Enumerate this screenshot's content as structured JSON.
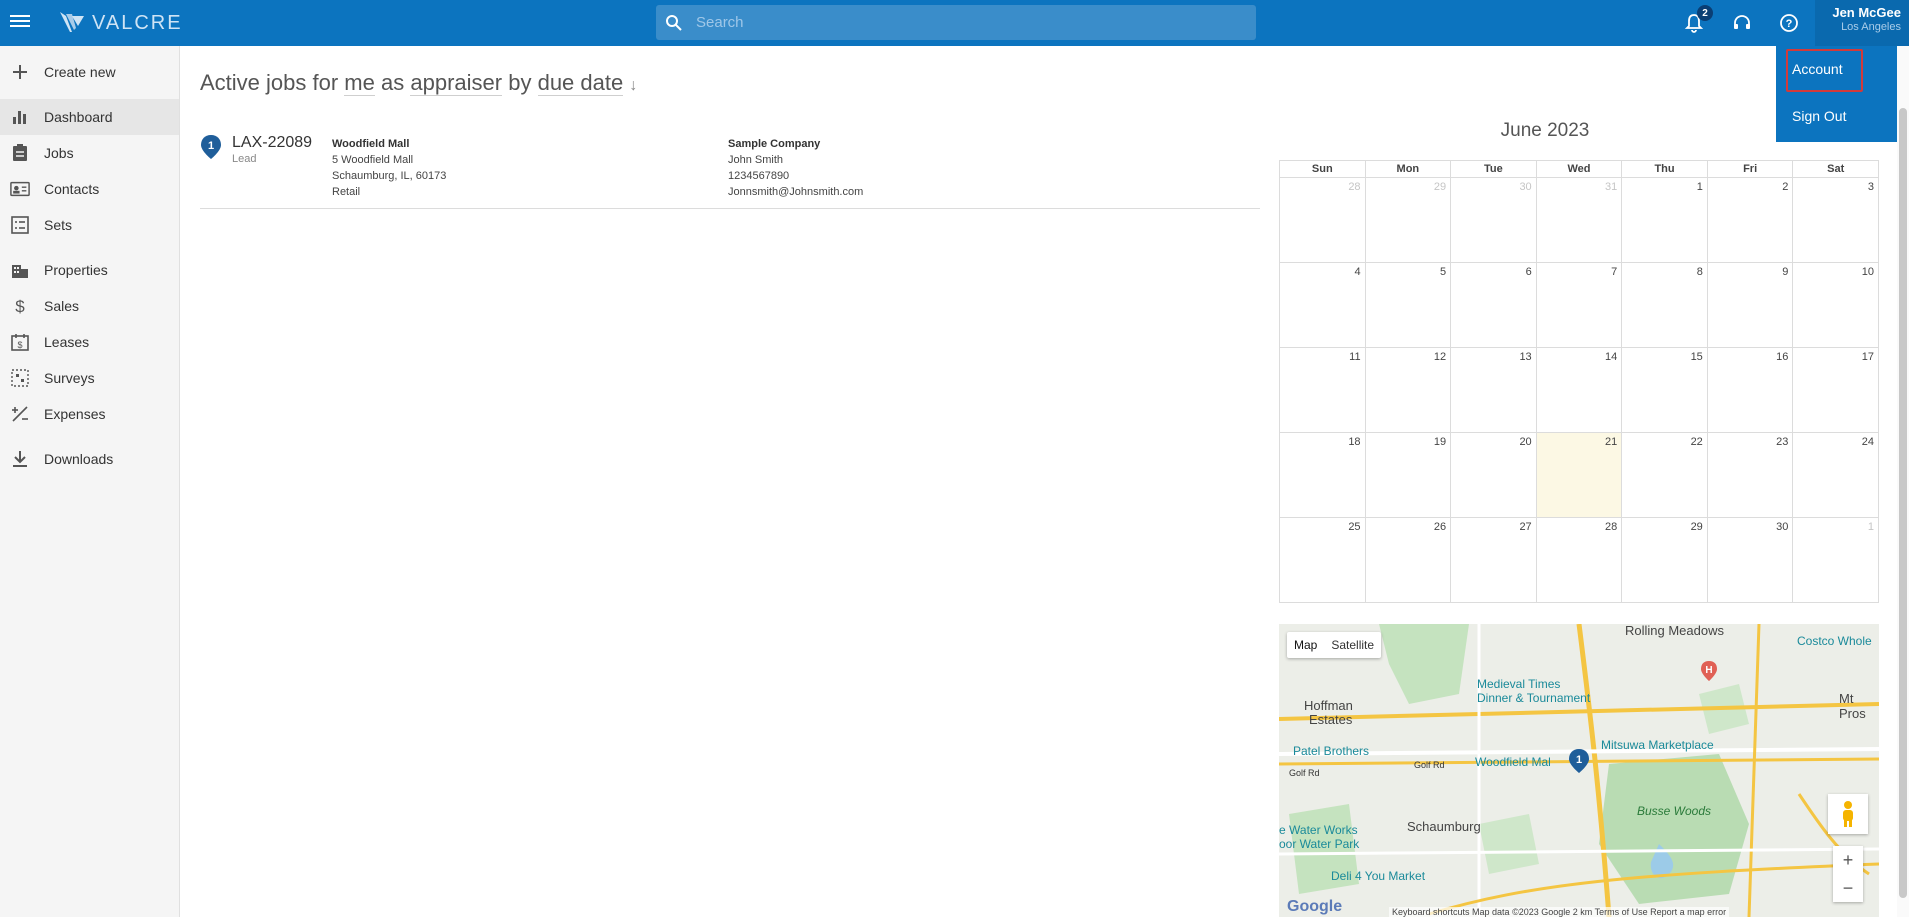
{
  "app": {
    "logo_text": "VALCRE"
  },
  "search": {
    "placeholder": "Search",
    "value": ""
  },
  "notifications": {
    "count": "2"
  },
  "user": {
    "name": "Jen McGee",
    "location": "Los Angeles"
  },
  "user_menu": {
    "items": [
      "Account",
      "Sign Out"
    ],
    "highlighted": "Account"
  },
  "sidebar": {
    "items": [
      {
        "label": "Create new",
        "icon": "plus-icon"
      },
      {
        "label": "Dashboard",
        "icon": "bar-chart-icon",
        "active": true
      },
      {
        "label": "Jobs",
        "icon": "clipboard-icon"
      },
      {
        "label": "Contacts",
        "icon": "contact-card-icon"
      },
      {
        "label": "Sets",
        "icon": "list-icon"
      },
      {
        "label": "Properties",
        "icon": "building-icon"
      },
      {
        "label": "Sales",
        "icon": "dollar-icon"
      },
      {
        "label": "Leases",
        "icon": "lease-icon"
      },
      {
        "label": "Surveys",
        "icon": "survey-icon"
      },
      {
        "label": "Expenses",
        "icon": "expense-icon"
      },
      {
        "label": "Downloads",
        "icon": "download-icon"
      }
    ]
  },
  "main": {
    "title_parts": {
      "prefix": "Active jobs for",
      "who": "me",
      "as": "as",
      "role": "appraiser",
      "by": "by",
      "sort": "due date",
      "arrow": "↓"
    },
    "jobs": [
      {
        "marker": "1",
        "id": "LAX-22089",
        "status": "Lead",
        "property_name": "Woodfield Mall",
        "address1": "5 Woodfield Mall",
        "address2": "Schaumburg, IL, 60173",
        "property_type": "Retail",
        "client_company": "Sample Company",
        "client_name": "John Smith",
        "client_phone": "1234567890",
        "client_email": "Jonnsmith@Johnsmith.com"
      }
    ]
  },
  "calendar": {
    "title": "June 2023",
    "weekdays": [
      "Sun",
      "Mon",
      "Tue",
      "Wed",
      "Thu",
      "Fri",
      "Sat"
    ],
    "weeks": [
      [
        "28",
        "29",
        "30",
        "31",
        "1",
        "2",
        "3"
      ],
      [
        "4",
        "5",
        "6",
        "7",
        "8",
        "9",
        "10"
      ],
      [
        "11",
        "12",
        "13",
        "14",
        "15",
        "16",
        "17"
      ],
      [
        "18",
        "19",
        "20",
        "21",
        "22",
        "23",
        "24"
      ],
      [
        "25",
        "26",
        "27",
        "28",
        "29",
        "30",
        "1"
      ]
    ],
    "today": "21"
  },
  "map": {
    "type_buttons": [
      "Map",
      "Satellite"
    ],
    "labels": {
      "rolling_meadows": "Rolling Meadows",
      "costco": "Costco Whole",
      "medieval_times_1": "Medieval Times",
      "medieval_times_2": "Dinner & Tournament",
      "hoffman_1": "Hoffman",
      "hoffman_2": "Estates",
      "mt_prospect": "Mt Pros",
      "mitsuwa": "Mitsuwa Marketplace",
      "patel": "Patel Brothers",
      "woodfield": "Woodfield Mal",
      "golf_rd_1": "Golf Rd",
      "golf_rd_2": "Golf Rd",
      "busse": "Busse Woods",
      "water_works_1": "e Water Works",
      "water_works_2": "oor Water Park",
      "schaumburg": "Schaumburg",
      "deli": "Deli 4 You Market",
      "marker": "1"
    },
    "footer": "Keyboard shortcuts   Map data ©2023 Google   2 km   Terms of Use   Report a map error",
    "google": "Google"
  },
  "colors": {
    "topbar": "#0c74bf",
    "sidebar": "#f5f5f5",
    "today": "#fcf8e4",
    "highlight_box": "#d23a3a"
  }
}
